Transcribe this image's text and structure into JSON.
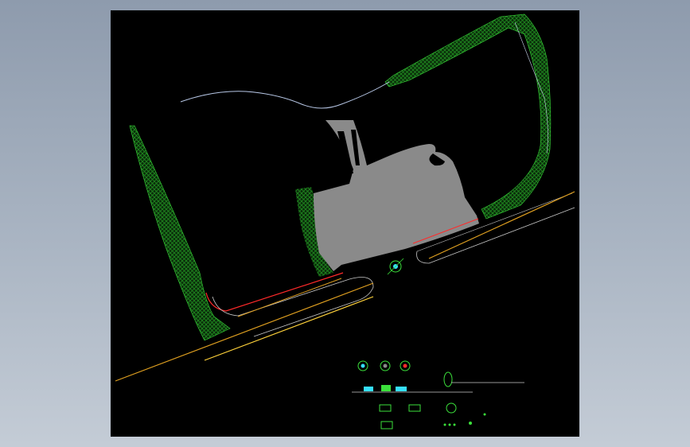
{
  "app": {
    "background_gradient": [
      "#8e9bad",
      "#c4ccd6"
    ]
  },
  "viewport": {
    "background": "#000000"
  },
  "drawing": {
    "colors": {
      "landscape_hatch": "#1f8a1f",
      "landscape_edge": "#39d639",
      "building": "#8a8a8a",
      "road_edge": "#e0a020",
      "road_edge_alt": "#ffd23a",
      "curb": "#c8c8c8",
      "river": "#b7c7e6",
      "red_line": "#ff2a2a",
      "detail_cyan": "#35e0ff",
      "detail_green": "#3be03b"
    },
    "legend_labels": []
  }
}
